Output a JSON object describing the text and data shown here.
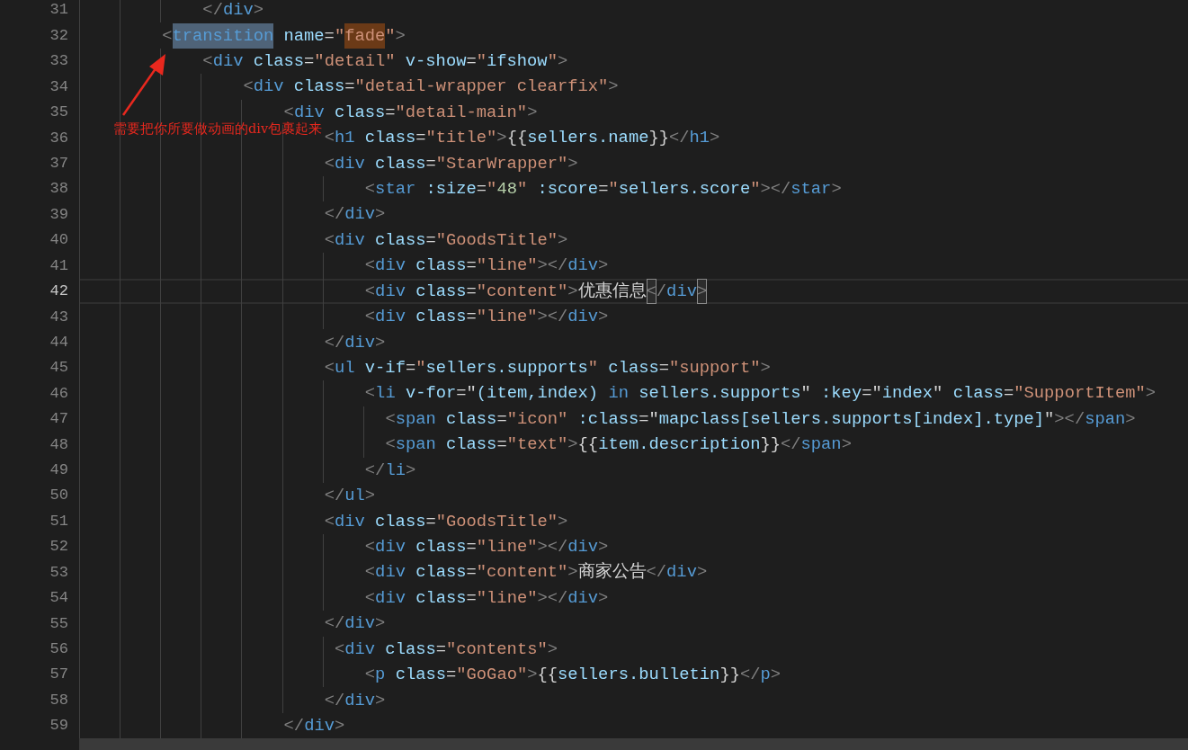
{
  "editor": {
    "lines": [
      {
        "number": "31",
        "current": false,
        "selected": false,
        "tokens": [
          {
            "kind": "bracket",
            "text": "            </"
          },
          {
            "kind": "tag",
            "text": "div"
          },
          {
            "kind": "bracket",
            "text": ">"
          }
        ]
      },
      {
        "number": "32",
        "current": false,
        "selected": false,
        "tokens": [
          {
            "kind": "bracket",
            "text": "        <"
          },
          {
            "kind": "selection",
            "text": "transition"
          },
          {
            "kind": "attr",
            "text": " name"
          },
          {
            "kind": "op",
            "text": "="
          },
          {
            "kind": "string",
            "text": "\""
          },
          {
            "kind": "match",
            "text": "fade"
          },
          {
            "kind": "string",
            "text": "\""
          },
          {
            "kind": "bracket",
            "text": ">"
          }
        ]
      },
      {
        "number": "33",
        "current": false,
        "selected": false,
        "tokens": [
          {
            "kind": "bracket",
            "text": "            <"
          },
          {
            "kind": "tag",
            "text": "div"
          },
          {
            "kind": "attr",
            "text": " class"
          },
          {
            "kind": "op",
            "text": "="
          },
          {
            "kind": "string",
            "text": "\"detail\""
          },
          {
            "kind": "attr",
            "text": " v-show"
          },
          {
            "kind": "op",
            "text": "="
          },
          {
            "kind": "string",
            "text": "\""
          },
          {
            "kind": "expr",
            "text": "ifshow"
          },
          {
            "kind": "string",
            "text": "\""
          },
          {
            "kind": "bracket",
            "text": ">"
          }
        ]
      },
      {
        "number": "34",
        "current": false,
        "selected": false,
        "tokens": [
          {
            "kind": "bracket",
            "text": "                <"
          },
          {
            "kind": "tag",
            "text": "div"
          },
          {
            "kind": "attr",
            "text": " class"
          },
          {
            "kind": "op",
            "text": "="
          },
          {
            "kind": "string",
            "text": "\"detail-wrapper clearfix\""
          },
          {
            "kind": "bracket",
            "text": ">"
          }
        ]
      },
      {
        "number": "35",
        "current": false,
        "selected": false,
        "tokens": [
          {
            "kind": "bracket",
            "text": "                    <"
          },
          {
            "kind": "tag",
            "text": "div"
          },
          {
            "kind": "attr",
            "text": " class"
          },
          {
            "kind": "op",
            "text": "="
          },
          {
            "kind": "string",
            "text": "\"detail-main\""
          },
          {
            "kind": "bracket",
            "text": ">"
          }
        ]
      },
      {
        "number": "36",
        "current": false,
        "selected": false,
        "tokens": [
          {
            "kind": "bracket",
            "text": "                        <"
          },
          {
            "kind": "tag",
            "text": "h1"
          },
          {
            "kind": "attr",
            "text": " class"
          },
          {
            "kind": "op",
            "text": "="
          },
          {
            "kind": "string",
            "text": "\"title\""
          },
          {
            "kind": "bracket",
            "text": ">"
          },
          {
            "kind": "text",
            "text": "{{"
          },
          {
            "kind": "expr",
            "text": "sellers.name"
          },
          {
            "kind": "text",
            "text": "}}"
          },
          {
            "kind": "bracket",
            "text": "</"
          },
          {
            "kind": "tag",
            "text": "h1"
          },
          {
            "kind": "bracket",
            "text": ">"
          }
        ]
      },
      {
        "number": "37",
        "current": false,
        "selected": false,
        "tokens": [
          {
            "kind": "bracket",
            "text": "                        <"
          },
          {
            "kind": "tag",
            "text": "div"
          },
          {
            "kind": "attr",
            "text": " class"
          },
          {
            "kind": "op",
            "text": "="
          },
          {
            "kind": "string",
            "text": "\"StarWrapper\""
          },
          {
            "kind": "bracket",
            "text": ">"
          }
        ]
      },
      {
        "number": "38",
        "current": false,
        "selected": false,
        "tokens": [
          {
            "kind": "bracket",
            "text": "                            <"
          },
          {
            "kind": "tag",
            "text": "star"
          },
          {
            "kind": "attr",
            "text": " :size"
          },
          {
            "kind": "op",
            "text": "="
          },
          {
            "kind": "string",
            "text": "\""
          },
          {
            "kind": "number",
            "text": "48"
          },
          {
            "kind": "string",
            "text": "\""
          },
          {
            "kind": "attr",
            "text": " :score"
          },
          {
            "kind": "op",
            "text": "="
          },
          {
            "kind": "string",
            "text": "\""
          },
          {
            "kind": "expr",
            "text": "sellers.score"
          },
          {
            "kind": "string",
            "text": "\""
          },
          {
            "kind": "bracket",
            "text": "></"
          },
          {
            "kind": "tag",
            "text": "star"
          },
          {
            "kind": "bracket",
            "text": ">"
          }
        ]
      },
      {
        "number": "39",
        "current": false,
        "selected": false,
        "tokens": [
          {
            "kind": "bracket",
            "text": "                        </"
          },
          {
            "kind": "tag",
            "text": "div"
          },
          {
            "kind": "bracket",
            "text": ">"
          }
        ]
      },
      {
        "number": "40",
        "current": false,
        "selected": false,
        "tokens": [
          {
            "kind": "bracket",
            "text": "                        <"
          },
          {
            "kind": "tag",
            "text": "div"
          },
          {
            "kind": "attr",
            "text": " class"
          },
          {
            "kind": "op",
            "text": "="
          },
          {
            "kind": "string",
            "text": "\"GoodsTitle\""
          },
          {
            "kind": "bracket",
            "text": ">"
          }
        ]
      },
      {
        "number": "41",
        "current": false,
        "selected": false,
        "tokens": [
          {
            "kind": "bracket",
            "text": "                            <"
          },
          {
            "kind": "tag",
            "text": "div"
          },
          {
            "kind": "attr",
            "text": " class"
          },
          {
            "kind": "op",
            "text": "="
          },
          {
            "kind": "string",
            "text": "\"line\""
          },
          {
            "kind": "bracket",
            "text": "></"
          },
          {
            "kind": "tag",
            "text": "div"
          },
          {
            "kind": "bracket",
            "text": ">"
          }
        ]
      },
      {
        "number": "42",
        "current": true,
        "selected": false,
        "tokens": [
          {
            "kind": "bracket",
            "text": "                            <"
          },
          {
            "kind": "tag",
            "text": "div"
          },
          {
            "kind": "attr",
            "text": " class"
          },
          {
            "kind": "op",
            "text": "="
          },
          {
            "kind": "string",
            "text": "\"content\""
          },
          {
            "kind": "bracket",
            "text": ">"
          },
          {
            "kind": "text",
            "text": "优惠信息"
          },
          {
            "kind": "bracketmatch",
            "text": "<"
          },
          {
            "kind": "bracket",
            "text": "/"
          },
          {
            "kind": "tag",
            "text": "div"
          },
          {
            "kind": "bracketmatch",
            "text": ">"
          }
        ]
      },
      {
        "number": "43",
        "current": false,
        "selected": false,
        "tokens": [
          {
            "kind": "bracket",
            "text": "                            <"
          },
          {
            "kind": "tag",
            "text": "div"
          },
          {
            "kind": "attr",
            "text": " class"
          },
          {
            "kind": "op",
            "text": "="
          },
          {
            "kind": "string",
            "text": "\"line\""
          },
          {
            "kind": "bracket",
            "text": "></"
          },
          {
            "kind": "tag",
            "text": "div"
          },
          {
            "kind": "bracket",
            "text": ">"
          }
        ]
      },
      {
        "number": "44",
        "current": false,
        "selected": false,
        "tokens": [
          {
            "kind": "bracket",
            "text": "                        </"
          },
          {
            "kind": "tag",
            "text": "div"
          },
          {
            "kind": "bracket",
            "text": ">"
          }
        ]
      },
      {
        "number": "45",
        "current": false,
        "selected": false,
        "tokens": [
          {
            "kind": "bracket",
            "text": "                        <"
          },
          {
            "kind": "tag",
            "text": "ul"
          },
          {
            "kind": "attr",
            "text": " v-if"
          },
          {
            "kind": "op",
            "text": "="
          },
          {
            "kind": "string",
            "text": "\""
          },
          {
            "kind": "expr",
            "text": "sellers.supports"
          },
          {
            "kind": "string",
            "text": "\""
          },
          {
            "kind": "attr",
            "text": " class"
          },
          {
            "kind": "op",
            "text": "="
          },
          {
            "kind": "string",
            "text": "\"support\""
          },
          {
            "kind": "bracket",
            "text": ">"
          }
        ]
      },
      {
        "number": "46",
        "current": false,
        "selected": false,
        "tokens": [
          {
            "kind": "bracket",
            "text": "                            <"
          },
          {
            "kind": "tag",
            "text": "li"
          },
          {
            "kind": "attr",
            "text": " v-for"
          },
          {
            "kind": "op",
            "text": "="
          },
          {
            "kind": "text",
            "text": "\""
          },
          {
            "kind": "expr",
            "text": "(item,index) "
          },
          {
            "kind": "keyword",
            "text": "in"
          },
          {
            "kind": "expr",
            "text": " sellers.supports"
          },
          {
            "kind": "text",
            "text": "\""
          },
          {
            "kind": "attr",
            "text": " :key"
          },
          {
            "kind": "op",
            "text": "="
          },
          {
            "kind": "text",
            "text": "\""
          },
          {
            "kind": "expr",
            "text": "index"
          },
          {
            "kind": "text",
            "text": "\""
          },
          {
            "kind": "attr",
            "text": " class"
          },
          {
            "kind": "op",
            "text": "="
          },
          {
            "kind": "string",
            "text": "\"SupportItem\""
          },
          {
            "kind": "bracket",
            "text": ">"
          }
        ]
      },
      {
        "number": "47",
        "current": false,
        "selected": false,
        "tokens": [
          {
            "kind": "bracket",
            "text": "                              <"
          },
          {
            "kind": "tag",
            "text": "span"
          },
          {
            "kind": "attr",
            "text": " class"
          },
          {
            "kind": "op",
            "text": "="
          },
          {
            "kind": "string",
            "text": "\"icon\""
          },
          {
            "kind": "attr",
            "text": " :class"
          },
          {
            "kind": "op",
            "text": "="
          },
          {
            "kind": "text",
            "text": "\""
          },
          {
            "kind": "expr",
            "text": "mapclass[sellers.supports[index].type]"
          },
          {
            "kind": "text",
            "text": "\""
          },
          {
            "kind": "bracket",
            "text": "></"
          },
          {
            "kind": "tag",
            "text": "span"
          },
          {
            "kind": "bracket",
            "text": ">"
          }
        ]
      },
      {
        "number": "48",
        "current": false,
        "selected": false,
        "tokens": [
          {
            "kind": "bracket",
            "text": "                              <"
          },
          {
            "kind": "tag",
            "text": "span"
          },
          {
            "kind": "attr",
            "text": " class"
          },
          {
            "kind": "op",
            "text": "="
          },
          {
            "kind": "string",
            "text": "\"text\""
          },
          {
            "kind": "bracket",
            "text": ">"
          },
          {
            "kind": "text",
            "text": "{{"
          },
          {
            "kind": "expr",
            "text": "item.description"
          },
          {
            "kind": "text",
            "text": "}}"
          },
          {
            "kind": "bracket",
            "text": "</"
          },
          {
            "kind": "tag",
            "text": "span"
          },
          {
            "kind": "bracket",
            "text": ">"
          }
        ]
      },
      {
        "number": "49",
        "current": false,
        "selected": false,
        "tokens": [
          {
            "kind": "bracket",
            "text": "                            </"
          },
          {
            "kind": "tag",
            "text": "li"
          },
          {
            "kind": "bracket",
            "text": ">"
          }
        ]
      },
      {
        "number": "50",
        "current": false,
        "selected": false,
        "tokens": [
          {
            "kind": "bracket",
            "text": "                        </"
          },
          {
            "kind": "tag",
            "text": "ul"
          },
          {
            "kind": "bracket",
            "text": ">"
          }
        ]
      },
      {
        "number": "51",
        "current": false,
        "selected": false,
        "tokens": [
          {
            "kind": "bracket",
            "text": "                        <"
          },
          {
            "kind": "tag",
            "text": "div"
          },
          {
            "kind": "attr",
            "text": " class"
          },
          {
            "kind": "op",
            "text": "="
          },
          {
            "kind": "string",
            "text": "\"GoodsTitle\""
          },
          {
            "kind": "bracket",
            "text": ">"
          }
        ]
      },
      {
        "number": "52",
        "current": false,
        "selected": false,
        "tokens": [
          {
            "kind": "bracket",
            "text": "                            <"
          },
          {
            "kind": "tag",
            "text": "div"
          },
          {
            "kind": "attr",
            "text": " class"
          },
          {
            "kind": "op",
            "text": "="
          },
          {
            "kind": "string",
            "text": "\"line\""
          },
          {
            "kind": "bracket",
            "text": "></"
          },
          {
            "kind": "tag",
            "text": "div"
          },
          {
            "kind": "bracket",
            "text": ">"
          }
        ]
      },
      {
        "number": "53",
        "current": false,
        "selected": false,
        "tokens": [
          {
            "kind": "bracket",
            "text": "                            <"
          },
          {
            "kind": "tag",
            "text": "div"
          },
          {
            "kind": "attr",
            "text": " class"
          },
          {
            "kind": "op",
            "text": "="
          },
          {
            "kind": "string",
            "text": "\"content\""
          },
          {
            "kind": "bracket",
            "text": ">"
          },
          {
            "kind": "text",
            "text": "商家公告"
          },
          {
            "kind": "bracket",
            "text": "</"
          },
          {
            "kind": "tag",
            "text": "div"
          },
          {
            "kind": "bracket",
            "text": ">"
          }
        ]
      },
      {
        "number": "54",
        "current": false,
        "selected": false,
        "tokens": [
          {
            "kind": "bracket",
            "text": "                            <"
          },
          {
            "kind": "tag",
            "text": "div"
          },
          {
            "kind": "attr",
            "text": " class"
          },
          {
            "kind": "op",
            "text": "="
          },
          {
            "kind": "string",
            "text": "\"line\""
          },
          {
            "kind": "bracket",
            "text": "></"
          },
          {
            "kind": "tag",
            "text": "div"
          },
          {
            "kind": "bracket",
            "text": ">"
          }
        ]
      },
      {
        "number": "55",
        "current": false,
        "selected": false,
        "tokens": [
          {
            "kind": "bracket",
            "text": "                        </"
          },
          {
            "kind": "tag",
            "text": "div"
          },
          {
            "kind": "bracket",
            "text": ">"
          }
        ]
      },
      {
        "number": "56",
        "current": false,
        "selected": false,
        "tokens": [
          {
            "kind": "bracket",
            "text": "                         <"
          },
          {
            "kind": "tag",
            "text": "div"
          },
          {
            "kind": "attr",
            "text": " class"
          },
          {
            "kind": "op",
            "text": "="
          },
          {
            "kind": "string",
            "text": "\"contents\""
          },
          {
            "kind": "bracket",
            "text": ">"
          }
        ]
      },
      {
        "number": "57",
        "current": false,
        "selected": false,
        "tokens": [
          {
            "kind": "bracket",
            "text": "                            <"
          },
          {
            "kind": "tag",
            "text": "p"
          },
          {
            "kind": "attr",
            "text": " class"
          },
          {
            "kind": "op",
            "text": "="
          },
          {
            "kind": "string",
            "text": "\"GoGao\""
          },
          {
            "kind": "bracket",
            "text": ">"
          },
          {
            "kind": "text",
            "text": "{{"
          },
          {
            "kind": "expr",
            "text": "sellers.bulletin"
          },
          {
            "kind": "text",
            "text": "}}"
          },
          {
            "kind": "bracket",
            "text": "</"
          },
          {
            "kind": "tag",
            "text": "p"
          },
          {
            "kind": "bracket",
            "text": ">"
          }
        ]
      },
      {
        "number": "58",
        "current": false,
        "selected": false,
        "tokens": [
          {
            "kind": "bracket",
            "text": "                        </"
          },
          {
            "kind": "tag",
            "text": "div"
          },
          {
            "kind": "bracket",
            "text": ">"
          }
        ]
      },
      {
        "number": "59",
        "current": false,
        "selected": false,
        "tokens": [
          {
            "kind": "bracket",
            "text": "                    </"
          },
          {
            "kind": "tag",
            "text": "div"
          },
          {
            "kind": "bracket",
            "text": ">"
          }
        ]
      },
      {
        "current": false,
        "selected": true
      }
    ]
  },
  "annotation": {
    "text": "需要把你所要做动画的div包裹起来"
  }
}
